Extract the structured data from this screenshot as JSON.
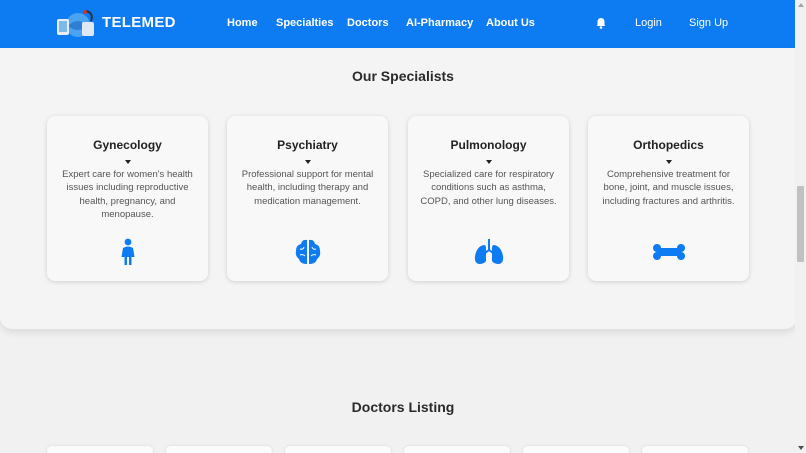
{
  "navbar": {
    "brand": "TELEMED",
    "links": [
      "Home",
      "Specialties",
      "Doctors",
      "AI-Pharmacy",
      "About Us"
    ],
    "login_label": "Login",
    "signup_label": "Sign Up",
    "logo_icon": "telemed-logo-icon",
    "notification_icon": "bell-icon",
    "accent_color": "#0d7bf2"
  },
  "specialists": {
    "title": "Our Specialists",
    "cards": [
      {
        "title": "Gynecology",
        "description": "Expert care for women's health issues including reproductive health, pregnancy, and menopause.",
        "icon": "female-figure-icon"
      },
      {
        "title": "Psychiatry",
        "description": "Professional support for mental health, including therapy and medication management.",
        "icon": "brain-icon"
      },
      {
        "title": "Pulmonology",
        "description": "Specialized care for respiratory conditions such as asthma, COPD, and other lung diseases.",
        "icon": "lungs-icon"
      },
      {
        "title": "Orthopedics",
        "description": "Comprehensive treatment for bone, joint, and muscle issues, including fractures and arthritis.",
        "icon": "bone-icon"
      }
    ]
  },
  "doctors": {
    "title": "Doctors Listing"
  }
}
